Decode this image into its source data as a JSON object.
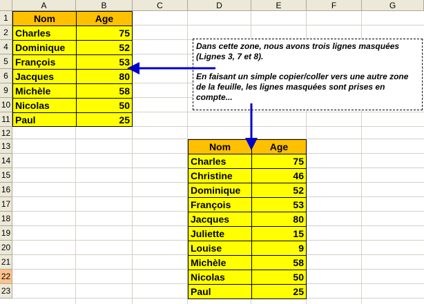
{
  "columns": [
    "A",
    "B",
    "C",
    "D",
    "E",
    "F",
    "G"
  ],
  "left_table": {
    "headers": [
      "Nom",
      "Age"
    ],
    "rows": [
      {
        "row": "2",
        "name": "Charles",
        "age": "75"
      },
      {
        "row": "4",
        "name": "Dominique",
        "age": "52"
      },
      {
        "row": "5",
        "name": "François",
        "age": "53"
      },
      {
        "row": "6",
        "name": "Jacques",
        "age": "80"
      },
      {
        "row": "9",
        "name": "Michèle",
        "age": "58"
      },
      {
        "row": "10",
        "name": "Nicolas",
        "age": "50"
      },
      {
        "row": "11",
        "name": "Paul",
        "age": "25"
      }
    ]
  },
  "row_headers": [
    "1",
    "2",
    "4",
    "5",
    "6",
    "9",
    "10",
    "11",
    "12",
    "13",
    "14",
    "15",
    "16",
    "17",
    "18",
    "19",
    "20",
    "21",
    "22",
    "23"
  ],
  "selected_row": "22",
  "right_table": {
    "headers": [
      "Nom",
      "Age"
    ],
    "rows": [
      {
        "name": "Charles",
        "age": "75"
      },
      {
        "name": "Christine",
        "age": "46"
      },
      {
        "name": "Dominique",
        "age": "52"
      },
      {
        "name": "François",
        "age": "53"
      },
      {
        "name": "Jacques",
        "age": "80"
      },
      {
        "name": "Juliette",
        "age": "15"
      },
      {
        "name": "Louise",
        "age": "9"
      },
      {
        "name": "Michèle",
        "age": "58"
      },
      {
        "name": "Nicolas",
        "age": "50"
      },
      {
        "name": "Paul",
        "age": "25"
      }
    ]
  },
  "note": {
    "line1": "Dans cette zone, nous avons trois lignes masquées (Lignes 3, 7 et 8).",
    "line2": "En faisant un simple copier/coller vers une autre zone de la feuille, les lignes masquées sont prises en compte..."
  },
  "colors": {
    "header_fill": "#ffc000",
    "cell_fill": "#ffff00",
    "arrow": "#0000cc",
    "selected_row_header": "#ffc28a"
  }
}
